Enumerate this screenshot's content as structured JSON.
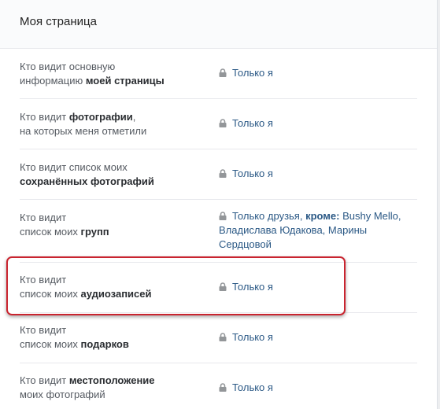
{
  "header": {
    "title": "Моя страница"
  },
  "rows": [
    {
      "label_pre": "Кто видит основную",
      "label_line2_pre": "информацию ",
      "label_bold": "моей страницы",
      "value": "Только я"
    },
    {
      "label_pre": "Кто видит ",
      "label_bold": "фотографии",
      "label_post": ",",
      "label_line2": "на которых меня отметили",
      "value": "Только я"
    },
    {
      "label_pre": "Кто видит список моих",
      "label_bold": "сохранённых фотографий",
      "value": "Только я"
    },
    {
      "label_pre": "Кто видит",
      "label_line2_pre": "список моих ",
      "label_bold": "групп",
      "value_pre": "Только друзья, ",
      "value_bold": "кроме:",
      "value_names": " Bushy Mello,",
      "value_line2": "Владислава Юдакова, Марины",
      "value_line3": "Сердцовой"
    },
    {
      "label_pre": "Кто видит",
      "label_line2_pre": "список моих ",
      "label_bold": "аудиозаписей",
      "value": "Только я"
    },
    {
      "label_pre": "Кто видит",
      "label_line2_pre": "список моих ",
      "label_bold": "подарков",
      "value": "Только я"
    },
    {
      "label_pre": "Кто видит ",
      "label_bold": "местоположение",
      "label_line2": "моих фотографий",
      "value": "Только я"
    }
  ],
  "icons": {
    "lock": "lock-icon"
  },
  "colors": {
    "link": "#2a5885",
    "highlight": "#c9242f"
  }
}
